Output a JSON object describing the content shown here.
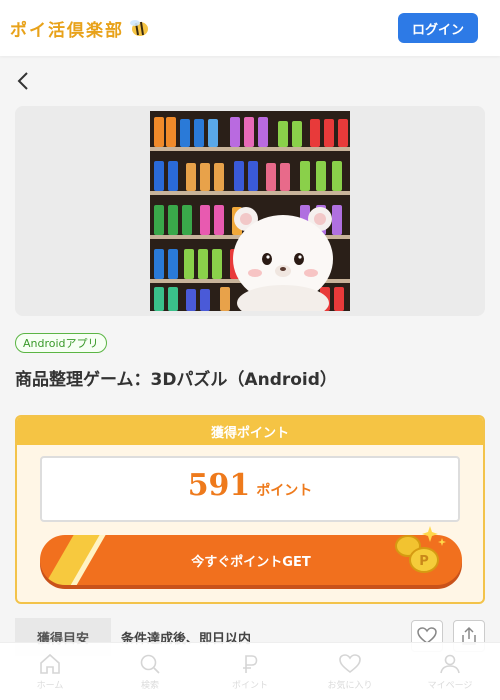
{
  "header": {
    "logo_text": "ポイ活倶楽部",
    "login_label": "ログイン"
  },
  "app": {
    "platform_tag": "Androidアプリ",
    "title": "商品整理ゲーム：3Dパズル（Android）"
  },
  "points": {
    "heading": "獲得ポイント",
    "value": "591",
    "unit": "ポイント",
    "button_label": "今すぐポイントGET"
  },
  "note": {
    "label": "獲得目安",
    "text": "条件達成後、即日以内"
  },
  "nav": {
    "items": [
      {
        "label": "ホーム",
        "icon": "home-icon"
      },
      {
        "label": "検索",
        "icon": "search-icon"
      },
      {
        "label": "ポイント",
        "icon": "point-icon"
      },
      {
        "label": "お気に入り",
        "icon": "heart-icon"
      },
      {
        "label": "マイページ",
        "icon": "user-icon"
      }
    ]
  },
  "colors": {
    "accent": "#2d7ae6",
    "orange": "#f1701e",
    "gold": "#f5c444",
    "green": "#5bb544"
  }
}
